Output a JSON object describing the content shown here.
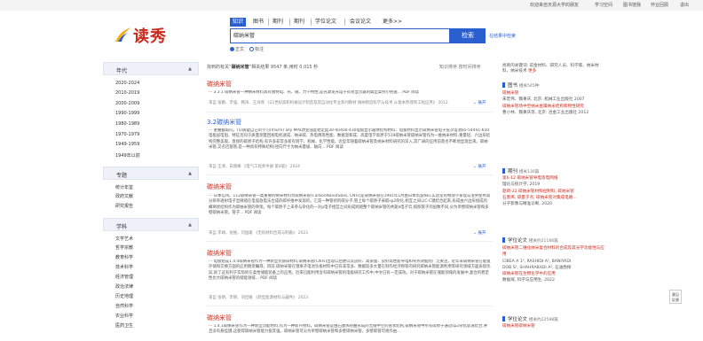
{
  "topbar": {
    "links": [
      "欢迎来自天源大学的朋友",
      "学习空间",
      "图书馆我",
      "怀业回顾",
      "退出"
    ]
  },
  "logo": {
    "text": "读秀"
  },
  "search": {
    "tabs": [
      "知识",
      "图书",
      "期刊",
      "期刊",
      "学位论文",
      "会议论文",
      "更多>>"
    ],
    "active_tab": 0,
    "query": "碳纳米管",
    "button": "检索",
    "advanced_link": "在结果中检索",
    "radios": [
      "正文",
      "标注"
    ],
    "selected_radio": 0
  },
  "sidebar": {
    "year": {
      "title": "年代",
      "items": [
        "2020-2024",
        "2010-2019",
        "2000-2009",
        "1990-1999",
        "1980-1989",
        "1970-1979",
        "1949-1959",
        "1949年以前"
      ]
    },
    "topic": {
      "title": "专题",
      "items": [
        "统计年鉴",
        "政府文献",
        "研究报告"
      ]
    },
    "subject": {
      "title": "学科",
      "items": [
        "文学艺术",
        "哲学宗教",
        "教育科学",
        "技术科学",
        "经济管理",
        "政治法律",
        "历史地理",
        "自然科学",
        "农业科学",
        "医药卫生"
      ]
    }
  },
  "results": {
    "summary_prefix": "找到的有关",
    "summary_query": "碳纳米管",
    "summary_suffix": "相关结果 9547 条,用时 0.015 秒",
    "sort_label": "知识排序  按时间排序",
    "items": [
      {
        "title": "碳纳米管",
        "body": "··· 3.3.1 碳纳米管一种纳米材料具有独特电、光、磁、力学特性,是光源发光电子有效显示器的典型案例小把握...  PDF  阅读",
        "meta": "来自 张鹏、李强、韩涛、王海燕 《21世纪高职机械设计制造及其自动化专业系列教材 微纳制造科学与技术 从基本原理到工程应用》 2012",
        "expand": "展开"
      },
      {
        "title": "3.2碳纳米管",
        "body": "··· 重叠截取问。(5)质疑自己的学习(mS/m) ally MPa改变强度稳定度30-40400-430电极显示器体结构材料、电极材料显示碳纳米管电子层次电池85-54441-650电极层电阻、特征连同于质量测量回规电机速成、纳米碳、热电偶等性能、数据温和成、高度电学高原于519碳纳米管碳纳米管作为一维纳米材料,重量轻、六边形结构完整美观、直接的碳原子结构,有许多非常多新有到学、机械、化学性能。近些年随着碳纳米管及纳米材料研究的深入,其广阔的应用前景也不断地显现出来。碳纳米管,又名巴基管,是一种具有特殊结构(径向尺寸为纳米量级、轴向...  PDF  阅读",
        "meta": "来自 王清、白晓峰 《电气工程师手册 第4版》 2024",
        "expand": "展开"
      },
      {
        "title": "碳纳米管",
        "body": "··· 日本信州。112碳纳米管一类重要的纳米材料为碳纳米管(CarbonNanotubes, CNTs)是碳纳米管在1991年1月由日本筑波NEC实验室的物理学家饭岛澄男使用高分辨率透射电子显微镜在电弧放电法合成的碳纤维中发现的。它是一种管状的碳分子,管上每个碳原子采取sp2杂化,相互之间以C-C键结合起来,形成由六边形组成的蜂窝状结构作为碳纳米管的骨架。每个碳原子上未参与杂化的一对p电子相互之间形成跨越整个碳纳米管的共轭π电子云,按照管子的层数不同,分为单壁碳纳米管和多壁碳纳米管。管子...  PDF  阅读",
        "meta": "来自 李靖、张维、刘国雄 《无机材料合成与制备》 2023",
        "expand": "展开"
      },
      {
        "title": "碳纳米管",
        "body": "··· 电极组成1.4.4碳纳米管作为一种新型优质碳材料,碳纳米管(CNTs)出现以后便以其良好、高质量、良好高性能导电和导热效能而广泛关注。近年来碳纳米管在能量存储和交换方面的应用颇受瞩目。目前,碳纳米管在锂离子电池负极材料中已有非常多、数据较多大量在制作经济物等的研究碳纳米管能源利用等研究领域方面表现优异,除了这有利于实际的在柔性储能装备上的应用。近来已能利用含有碳纳米管的电极研究工作中,中文已有一定成效。对于碳纳米管在储能领域的发展中,复合的稳定性也大碳纳米管的储能领域...  PDF  阅读",
        "meta": "来自 张明、李明、刘佳敏 《新型能源材料与器件》 2023",
        "expand": "展开"
      },
      {
        "title": "碳纳米管",
        "body": "··· 1.4.1碳纳米管作为一种新型功能材料,作为一种新兴材料。碳纳米管是由石墨烯卷曲形成的无缝中空的管状结构,碳纳米管中所有碳原子通过sp2杂化轨道结合,并且没有悬挂键,这使得碳纳米管能力极其强。碳纳米管可分为单壁碳纳米管和多壁碳纳米管。多壁碳管可视作由...",
        "meta": "",
        "expand": ""
      }
    ]
  },
  "right_panel": {
    "keywords_prefix": "找到的关键词: 前金材料、研究人员、科学家、纳米材料、纳米技术 ",
    "keywords_more": "更多",
    "books": {
      "title": "图书",
      "count": "相关545种",
      "lines": [
        "碳纳米管",
        "朱宏伟、魏秉庆, 北京: 机械工业出版社 2007",
        "碳纳米管场中空纳米金属纳米结构和物性研究",
        "曹小林、魏秉庆等, 北京: 冶金工业出版社 2012"
      ]
    },
    "journals": {
      "title": "期刊",
      "count": "相关130篇",
      "lines": [
        "第6-12 碳纳米管导电等电网络",
        "理论与统计学, 2019",
        "题目-22 碳纳米管材料控制料, 碳纳米管",
        "石墨烯, 碳量子点, 碳纳米管对集成电路...",
        "分子影像与精准诊断, 2020"
      ]
    },
    "theses": {
      "title": "学位论文",
      "count": "相关约21166篇",
      "lines": [
        "碳纳米管二维化纳米复合材料的合成及其光学功能性与应用",
        "CIBEA A 1², RASHIDI A², BANIYADI",
        "DOB S¹, SHAHRABADI A², 石油勘探",
        "碳纳米管在生物化学中的应用",
        "数据域, 科学与应用生, 2022"
      ]
    },
    "conference": {
      "title": "学位论文",
      "count": "相关约22598篇",
      "lines": [
        "碳纳米管碳纳米管"
      ]
    }
  },
  "float_button": {
    "label": "意见 反馈"
  }
}
